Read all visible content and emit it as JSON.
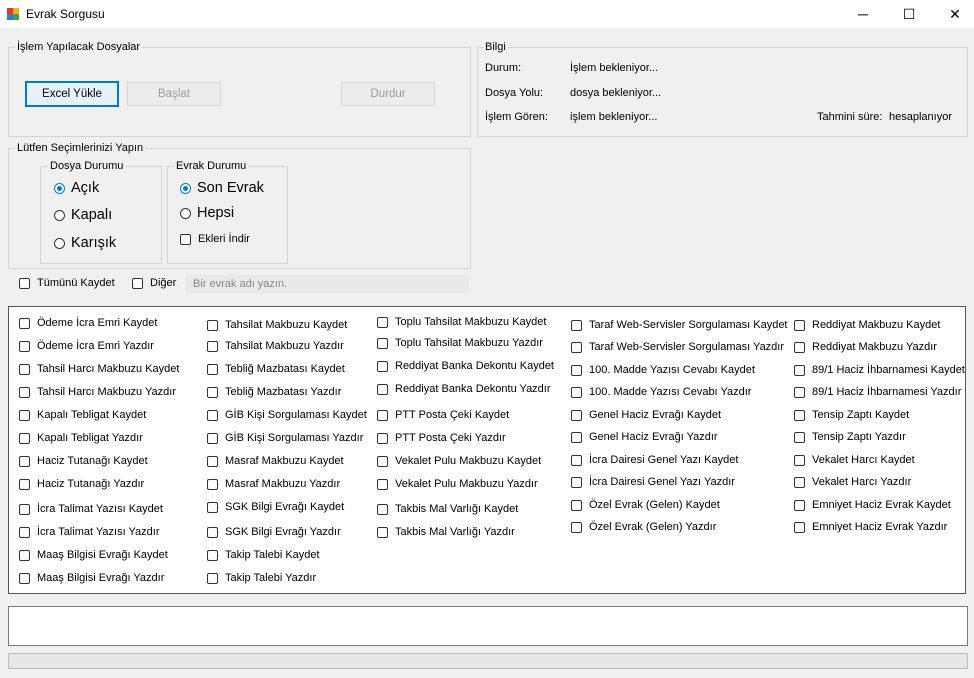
{
  "window": {
    "title": "Evrak Sorgusu",
    "minimize": "─",
    "maximize": "☐",
    "close": "✕"
  },
  "files_group": {
    "legend": "İşlem Yapılacak Dosyalar",
    "excel_button": "Excel Yükle",
    "start_button": "Başlat",
    "stop_button": "Durdur"
  },
  "info_group": {
    "legend": "Bilgi",
    "status_label": "Durum:",
    "status_value": "İşlem bekleniyor...",
    "path_label": "Dosya Yolu:",
    "path_value": "dosya bekleniyor...",
    "processed_label": "İşlem Gören:",
    "processed_value": "işlem bekleniyor...",
    "eta_label": "Tahmini süre:",
    "eta_value": "hesaplanıyor"
  },
  "selection_group": {
    "legend": "Lütfen Seçimlerinizi Yapın",
    "file_status": {
      "legend": "Dosya Durumu",
      "options": [
        "Açık",
        "Kapalı",
        "Karışık"
      ],
      "selected": "Açık"
    },
    "doc_status": {
      "legend": "Evrak Durumu",
      "options": [
        "Son Evrak",
        "Hepsi"
      ],
      "selected": "Son Evrak",
      "attachments_label": "Ekleri İndir"
    }
  },
  "save_all_label": "Tümünü Kaydet",
  "other_label": "Diğer",
  "other_placeholder": "Bir evrak adı yazın.",
  "documents": [
    [
      "Ödeme İcra Emri Kaydet",
      "Ödeme İcra Emri Yazdır",
      "Tahsil Harcı Makbuzu Kaydet",
      "Tahsil Harcı Makbuzu Yazdır",
      "Kapalı Tebligat Kaydet",
      "Kapalı Tebligat Yazdır",
      "Haciz Tutanağı Kaydet",
      "Haciz Tutanağı Yazdır",
      "İcra Talimat Yazısı Kaydet",
      "İcra Talimat Yazısı Yazdır",
      "Maaş Bilgisi Evrağı Kaydet",
      "Maaş Bilgisi Evrağı Yazdır"
    ],
    [
      "Tahsilat Makbuzu Kaydet",
      "Tahsilat Makbuzu Yazdır",
      "Tebliğ Mazbatası Kaydet",
      "Tebliğ Mazbatası Yazdır",
      "GİB Kişi Sorgulaması Kaydet",
      "GİB Kişi Sorgulaması Yazdır",
      "Masraf Makbuzu Kaydet",
      "Masraf Makbuzu Yazdır",
      "SGK Bilgi Evrağı Kaydet",
      "SGK Bilgi Evrağı Yazdır",
      "Takip Talebi Kaydet",
      "Takip Talebi Yazdır"
    ],
    [
      "Toplu Tahsilat Makbuzu Kaydet",
      "Toplu Tahsilat Makbuzu Yazdır",
      "Reddiyat Banka Dekontu Kaydet",
      "Reddiyat Banka Dekontu Yazdır",
      "PTT Posta Çeki Kaydet",
      "PTT Posta Çeki Yazdır",
      "Vekalet Pulu Makbuzu Kaydet",
      "Vekalet Pulu Makbuzu Yazdır",
      "Takbis Mal Varlığı Kaydet",
      "Takbis Mal Varlığı Yazdır"
    ],
    [
      "Taraf Web-Servisler Sorgulaması Kaydet",
      "Taraf Web-Servisler Sorgulaması Yazdır",
      "100. Madde Yazısı Cevabı Kaydet",
      "100. Madde Yazısı Cevabı Yazdır",
      "Genel Haciz Evrağı Kaydet",
      "Genel Haciz Evrağı Yazdır",
      "İcra Dairesi Genel Yazı Kaydet",
      "İcra Dairesi Genel Yazı Yazdır",
      "Özel Evrak (Gelen) Kaydet",
      "Özel Evrak (Gelen) Yazdır"
    ],
    [
      "Reddiyat Makbuzu Kaydet",
      "Reddiyat Makbuzu Yazdır",
      "89/1 Haciz İhbarnamesi Kaydet",
      "89/1 Haciz İhbarnamesi Yazdır",
      "Tensip Zaptı Kaydet",
      "Tensip Zaptı Yazdır",
      "Vekalet Harcı Kaydet",
      "Vekalet Harcı Yazdır",
      "Emniyet Haciz Evrak Kaydet",
      "Emniyet Haciz Evrak Yazdır"
    ]
  ],
  "output_text": "",
  "progress": 0
}
